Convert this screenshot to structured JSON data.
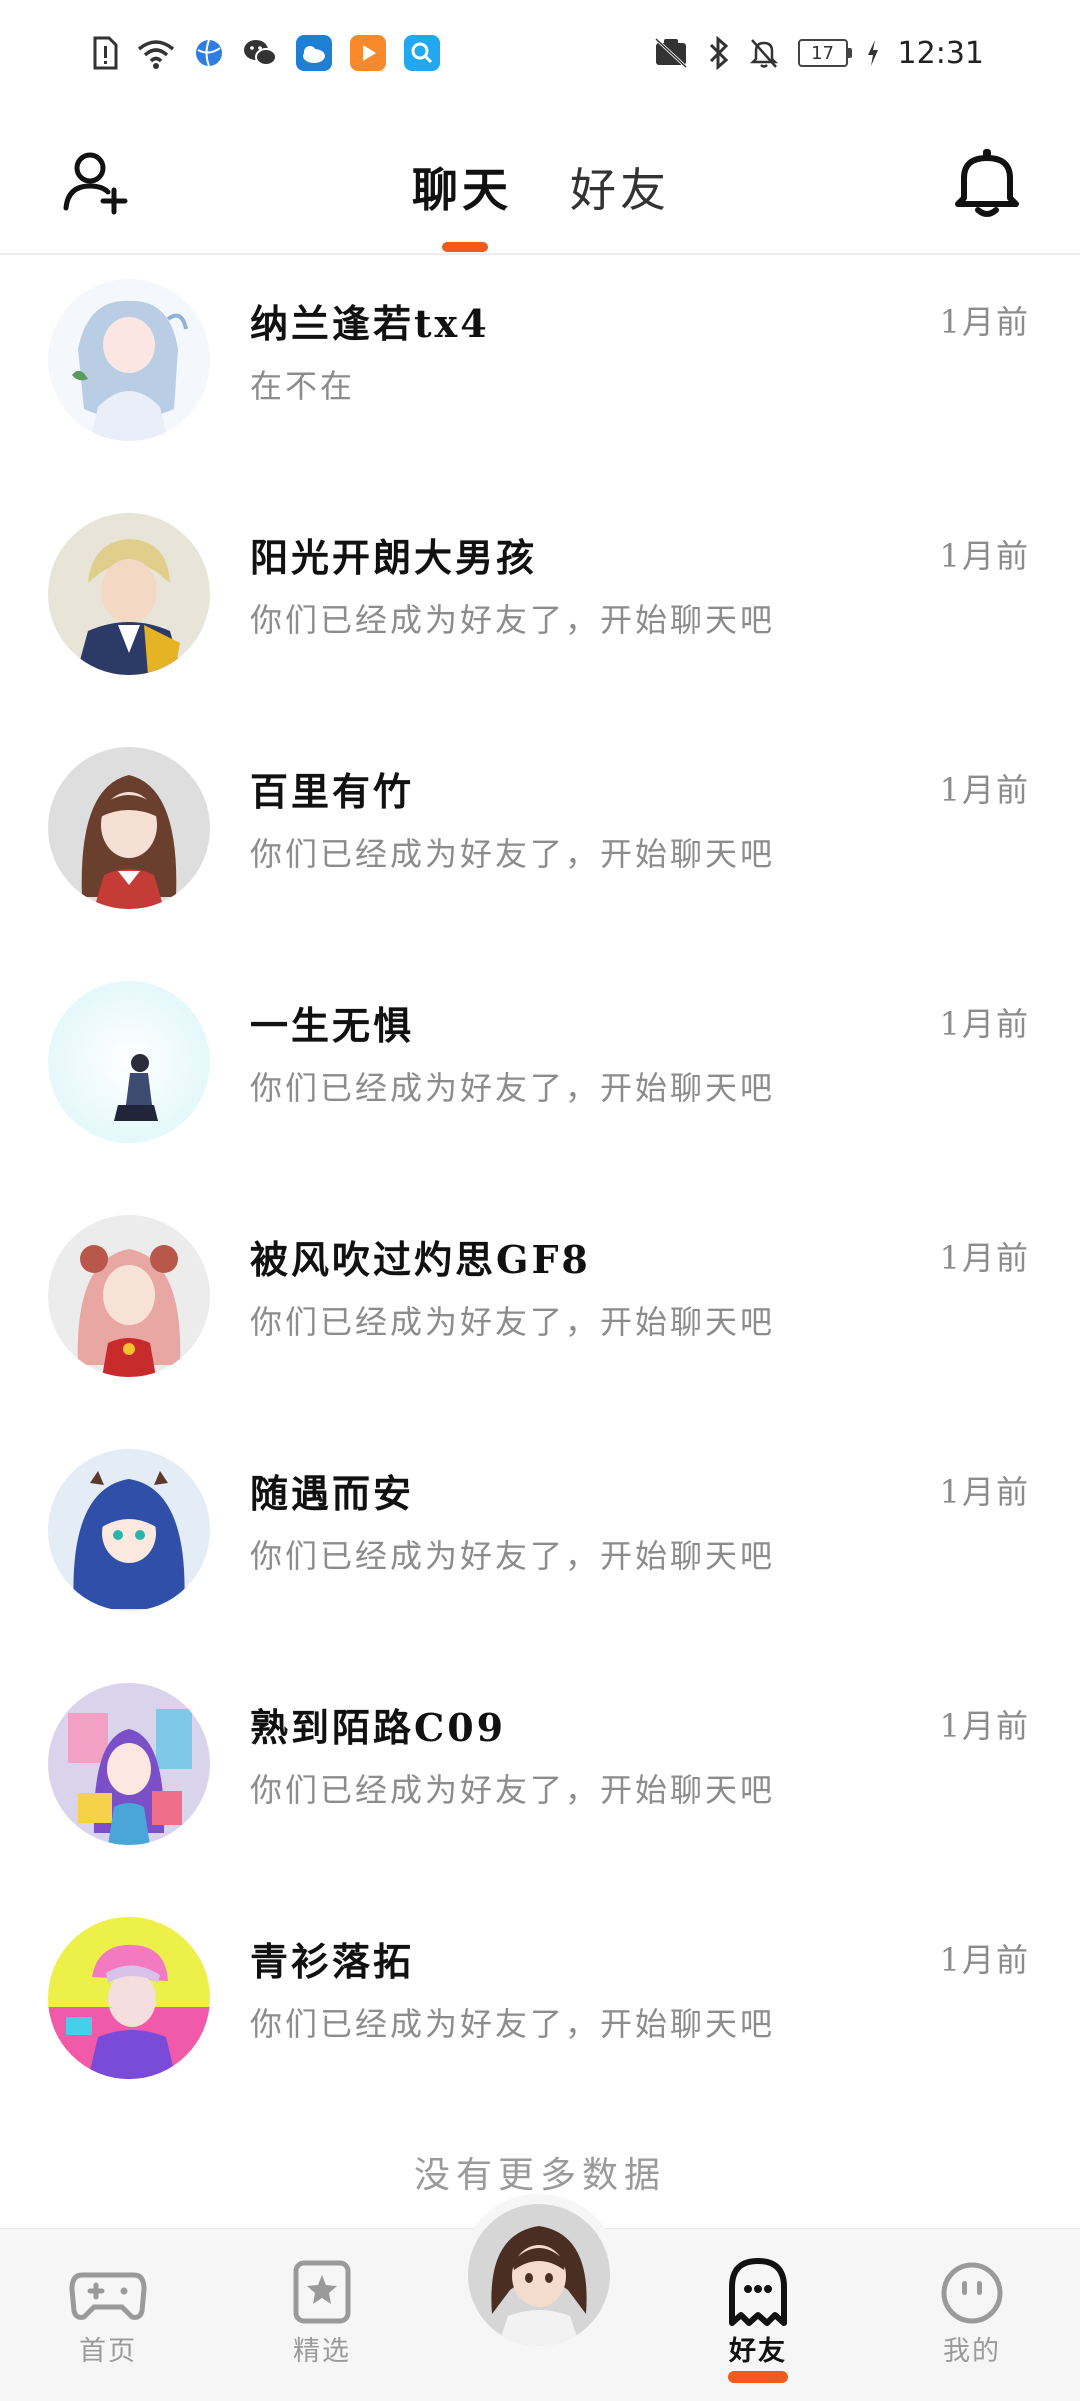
{
  "status_bar": {
    "time": "12:31",
    "battery": "17"
  },
  "header": {
    "tabs": [
      {
        "label": "聊天",
        "active": true
      },
      {
        "label": "好友",
        "active": false
      }
    ]
  },
  "chats": [
    {
      "name": "纳兰逢若tx4",
      "message": "在不在",
      "time": "1月前"
    },
    {
      "name": "阳光开朗大男孩",
      "message": "你们已经成为好友了，开始聊天吧",
      "time": "1月前"
    },
    {
      "name": "百里有竹",
      "message": "你们已经成为好友了，开始聊天吧",
      "time": "1月前"
    },
    {
      "name": "一生无惧",
      "message": "你们已经成为好友了，开始聊天吧",
      "time": "1月前"
    },
    {
      "name": "被风吹过灼思GF8",
      "message": "你们已经成为好友了，开始聊天吧",
      "time": "1月前"
    },
    {
      "name": "随遇而安",
      "message": "你们已经成为好友了，开始聊天吧",
      "time": "1月前"
    },
    {
      "name": "熟到陌路C09",
      "message": "你们已经成为好友了，开始聊天吧",
      "time": "1月前"
    },
    {
      "name": "青衫落拓",
      "message": "你们已经成为好友了，开始聊天吧",
      "time": "1月前"
    }
  ],
  "list_footer": "没有更多数据",
  "bottom_nav": [
    {
      "label": "首页",
      "icon": "gamepad-icon",
      "active": false
    },
    {
      "label": "精选",
      "icon": "star-icon",
      "active": false
    },
    {
      "label": "好友",
      "icon": "ghost-icon",
      "active": true
    },
    {
      "label": "我的",
      "icon": "smiley-icon",
      "active": false
    }
  ],
  "colors": {
    "accent": "#f05a1c",
    "text_primary": "#111111",
    "text_secondary": "#8c8c8c",
    "nav_background": "#f6f6f6"
  }
}
